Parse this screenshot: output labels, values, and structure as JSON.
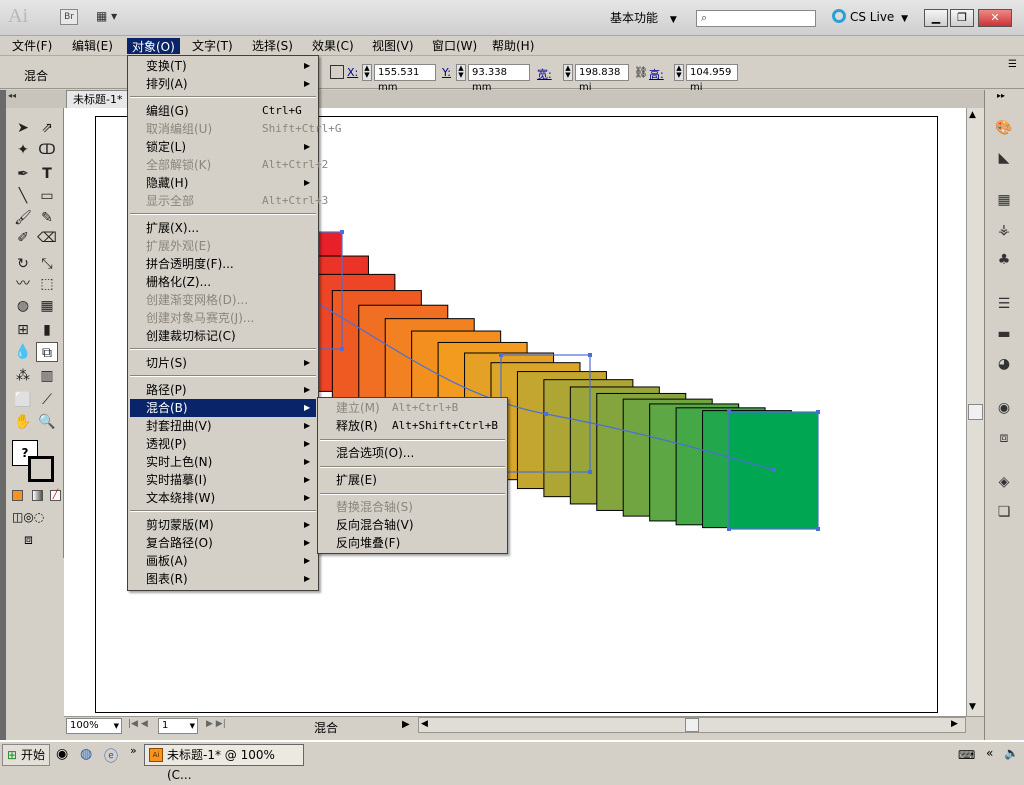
{
  "titlebar": {
    "app_logo": "Ai",
    "bridge_label": "Br",
    "workspace_label": "基本功能",
    "search_placeholder": "",
    "cslive_label": "CS Live"
  },
  "menubar": {
    "items": [
      "文件(F)",
      "编辑(E)",
      "对象(O)",
      "文字(T)",
      "选择(S)",
      "效果(C)",
      "视图(V)",
      "窗口(W)",
      "帮助(H)"
    ]
  },
  "control": {
    "mode_label": "混合",
    "x_label": "X:",
    "x_value": "155.531 mm",
    "y_label": "Y:",
    "y_value": "93.338 mm",
    "w_label": "宽:",
    "w_value": "198.838 mi",
    "h_label": "高:",
    "h_value": "104.959 mi"
  },
  "document": {
    "tab_title": "未标题-1*"
  },
  "object_menu": {
    "items": [
      {
        "label": "变换(T)",
        "shortcut": "",
        "submenu": true,
        "disabled": false
      },
      {
        "label": "排列(A)",
        "shortcut": "",
        "submenu": true,
        "disabled": false
      },
      {
        "label": "编组(G)",
        "shortcut": "Ctrl+G",
        "submenu": false,
        "disabled": false
      },
      {
        "label": "取消编组(U)",
        "shortcut": "Shift+Ctrl+G",
        "submenu": false,
        "disabled": true
      },
      {
        "label": "锁定(L)",
        "shortcut": "",
        "submenu": true,
        "disabled": false
      },
      {
        "label": "全部解锁(K)",
        "shortcut": "Alt+Ctrl+2",
        "submenu": false,
        "disabled": true
      },
      {
        "label": "隐藏(H)",
        "shortcut": "",
        "submenu": true,
        "disabled": false
      },
      {
        "label": "显示全部",
        "shortcut": "Alt+Ctrl+3",
        "submenu": false,
        "disabled": true
      },
      {
        "label": "扩展(X)...",
        "shortcut": "",
        "submenu": false,
        "disabled": false
      },
      {
        "label": "扩展外观(E)",
        "shortcut": "",
        "submenu": false,
        "disabled": true
      },
      {
        "label": "拼合透明度(F)...",
        "shortcut": "",
        "submenu": false,
        "disabled": false
      },
      {
        "label": "栅格化(Z)...",
        "shortcut": "",
        "submenu": false,
        "disabled": false
      },
      {
        "label": "创建渐变网格(D)...",
        "shortcut": "",
        "submenu": false,
        "disabled": true
      },
      {
        "label": "创建对象马赛克(J)...",
        "shortcut": "",
        "submenu": false,
        "disabled": true
      },
      {
        "label": "创建裁切标记(C)",
        "shortcut": "",
        "submenu": false,
        "disabled": false
      },
      {
        "label": "切片(S)",
        "shortcut": "",
        "submenu": true,
        "disabled": false
      },
      {
        "label": "路径(P)",
        "shortcut": "",
        "submenu": true,
        "disabled": false
      },
      {
        "label": "混合(B)",
        "shortcut": "",
        "submenu": true,
        "disabled": false
      },
      {
        "label": "封套扭曲(V)",
        "shortcut": "",
        "submenu": true,
        "disabled": false
      },
      {
        "label": "透视(P)",
        "shortcut": "",
        "submenu": true,
        "disabled": false
      },
      {
        "label": "实时上色(N)",
        "shortcut": "",
        "submenu": true,
        "disabled": false
      },
      {
        "label": "实时描摹(I)",
        "shortcut": "",
        "submenu": true,
        "disabled": false
      },
      {
        "label": "文本绕排(W)",
        "shortcut": "",
        "submenu": true,
        "disabled": false
      },
      {
        "label": "剪切蒙版(M)",
        "shortcut": "",
        "submenu": true,
        "disabled": false
      },
      {
        "label": "复合路径(O)",
        "shortcut": "",
        "submenu": true,
        "disabled": false
      },
      {
        "label": "画板(A)",
        "shortcut": "",
        "submenu": true,
        "disabled": false
      },
      {
        "label": "图表(R)",
        "shortcut": "",
        "submenu": true,
        "disabled": false
      }
    ]
  },
  "blend_menu": {
    "items": [
      {
        "label": "建立(M)",
        "shortcut": "Alt+Ctrl+B",
        "disabled": true
      },
      {
        "label": "释放(R)",
        "shortcut": "Alt+Shift+Ctrl+B",
        "disabled": false
      },
      {
        "label": "混合选项(O)...",
        "shortcut": "",
        "disabled": false
      },
      {
        "label": "扩展(E)",
        "shortcut": "",
        "disabled": false
      },
      {
        "label": "替换混合轴(S)",
        "shortcut": "",
        "disabled": true
      },
      {
        "label": "反向混合轴(V)",
        "shortcut": "",
        "disabled": false
      },
      {
        "label": "反向堆叠(F)",
        "shortcut": "",
        "disabled": false
      }
    ]
  },
  "status": {
    "zoom": "100%",
    "page": "1",
    "mode": "混合"
  },
  "taskbar": {
    "start_label": "开始",
    "task_label": "未标题-1* @ 100% (C..."
  },
  "colors": {
    "blend_start": "#e8202a",
    "blend_end": "#00a651",
    "selection": "#4a6fd8",
    "menu_highlight": "#0a246a"
  }
}
